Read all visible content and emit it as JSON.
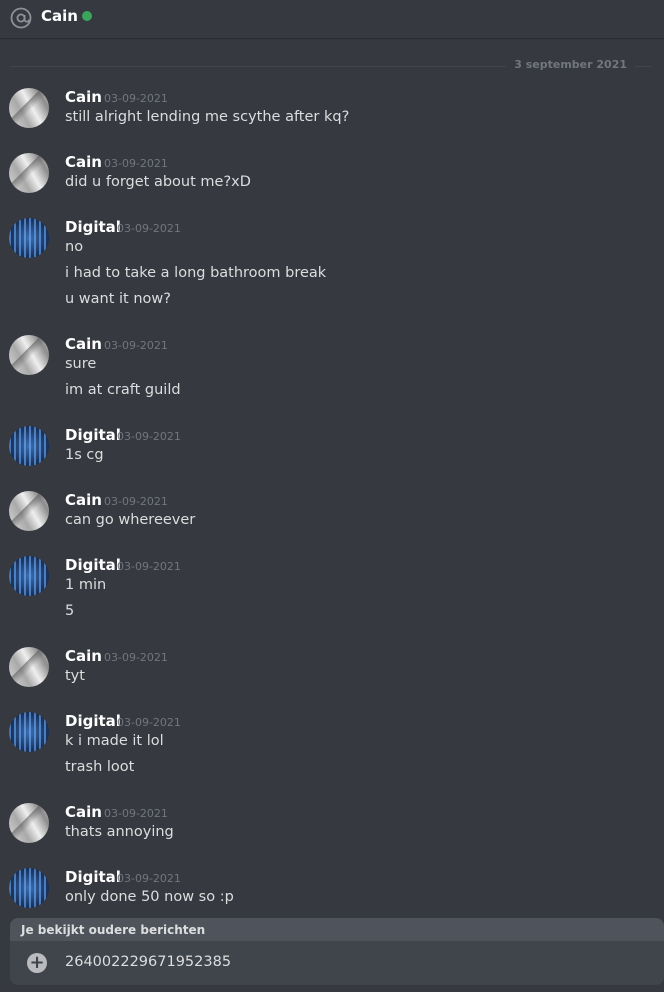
{
  "header": {
    "name": "Cain",
    "status_color": "#3ba55c",
    "icon": "at-icon"
  },
  "divider": {
    "date": "3 september 2021"
  },
  "messages": [
    {
      "author": "Cain",
      "avatar": "cain",
      "timestamp": "03-09-2021",
      "lines": [
        "still alright lending me scythe after kq?"
      ]
    },
    {
      "author": "Cain",
      "avatar": "cain",
      "timestamp": "03-09-2021",
      "lines": [
        "did u forget about me?xD"
      ]
    },
    {
      "author": "Digital",
      "avatar": "digital",
      "timestamp": "03-09-2021",
      "lines": [
        "no",
        "i had to take a long bathroom break",
        "u want it now?"
      ]
    },
    {
      "author": "Cain",
      "avatar": "cain",
      "timestamp": "03-09-2021",
      "lines": [
        "sure",
        "im at craft guild"
      ]
    },
    {
      "author": "Digital",
      "avatar": "digital",
      "timestamp": "03-09-2021",
      "lines": [
        "1s cg"
      ]
    },
    {
      "author": "Cain",
      "avatar": "cain",
      "timestamp": "03-09-2021",
      "lines": [
        "can go whereever"
      ]
    },
    {
      "author": "Digital",
      "avatar": "digital",
      "timestamp": "03-09-2021",
      "lines": [
        "1 min",
        "5"
      ]
    },
    {
      "author": "Cain",
      "avatar": "cain",
      "timestamp": "03-09-2021",
      "lines": [
        "tyt"
      ]
    },
    {
      "author": "Digital",
      "avatar": "digital",
      "timestamp": "03-09-2021",
      "lines": [
        "k i made it lol",
        "trash loot"
      ]
    },
    {
      "author": "Cain",
      "avatar": "cain",
      "timestamp": "03-09-2021",
      "lines": [
        "thats annoying"
      ]
    },
    {
      "author": "Digital",
      "avatar": "digital",
      "timestamp": "03-09-2021",
      "lines": [
        "only done 50 now so :p"
      ]
    }
  ],
  "notice": {
    "text": "Je bekijkt oudere berichten"
  },
  "composer": {
    "value": "264002229671952385",
    "icon": "plus-circle-icon"
  }
}
